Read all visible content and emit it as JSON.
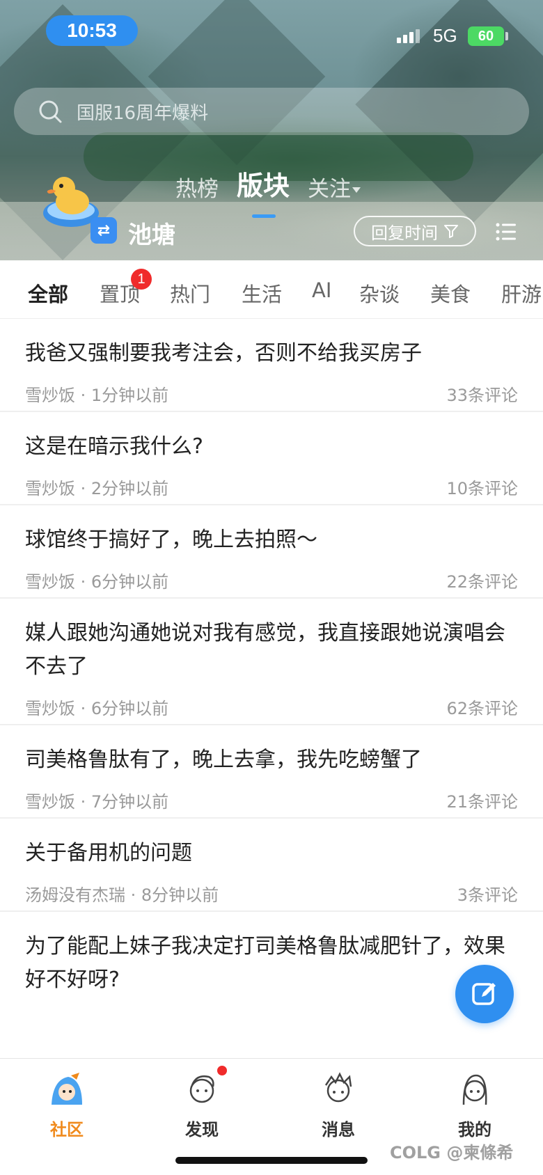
{
  "status_bar": {
    "time": "10:53",
    "network": "5G",
    "battery": "60"
  },
  "search": {
    "placeholder": "国服16周年爆料"
  },
  "top_tabs": [
    {
      "label": "热榜",
      "active": false
    },
    {
      "label": "版块",
      "active": true
    },
    {
      "label": "关注",
      "active": false
    }
  ],
  "board": {
    "name": "池塘",
    "sort_label": "回复时间"
  },
  "categories": [
    {
      "label": "全部",
      "active": true
    },
    {
      "label": "置顶",
      "badge": "1"
    },
    {
      "label": "热门"
    },
    {
      "label": "生活"
    },
    {
      "label": "AI"
    },
    {
      "label": "杂谈"
    },
    {
      "label": "美食"
    },
    {
      "label": "肝游"
    }
  ],
  "posts": [
    {
      "title": "我爸又强制要我考注会，否则不给我买房子",
      "author": "雪炒饭",
      "time": "1分钟以前",
      "comments": "33条评论"
    },
    {
      "title": "这是在暗示我什么?",
      "author": "雪炒饭",
      "time": "2分钟以前",
      "comments": "10条评论"
    },
    {
      "title": "球馆终于搞好了，晚上去拍照～",
      "author": "雪炒饭",
      "time": "6分钟以前",
      "comments": "22条评论"
    },
    {
      "title": "媒人跟她沟通她说对我有感觉，我直接跟她说演唱会不去了",
      "author": "雪炒饭",
      "time": "6分钟以前",
      "comments": "62条评论"
    },
    {
      "title": "司美格鲁肽有了，晚上去拿，我先吃螃蟹了",
      "author": "雪炒饭",
      "time": "7分钟以前",
      "comments": "21条评论"
    },
    {
      "title": "关于备用机的问题",
      "author": "汤姆没有杰瑞",
      "time": "8分钟以前",
      "comments": "3条评论"
    },
    {
      "title": "为了能配上妹子我决定打司美格鲁肽减肥针了，效果好不好呀?",
      "author": "",
      "time": "",
      "comments": ""
    }
  ],
  "bottom_nav": [
    {
      "label": "社区",
      "active": true,
      "icon": "community-icon"
    },
    {
      "label": "发现",
      "active": false,
      "icon": "discover-icon",
      "dot": true
    },
    {
      "label": "消息",
      "active": false,
      "icon": "messages-icon"
    },
    {
      "label": "我的",
      "active": false,
      "icon": "profile-icon"
    }
  ],
  "watermark": "COLG @柬條希",
  "colors": {
    "accent": "#2f8ff0",
    "nav_active": "#f08a1c",
    "badge": "#f02b2b"
  }
}
